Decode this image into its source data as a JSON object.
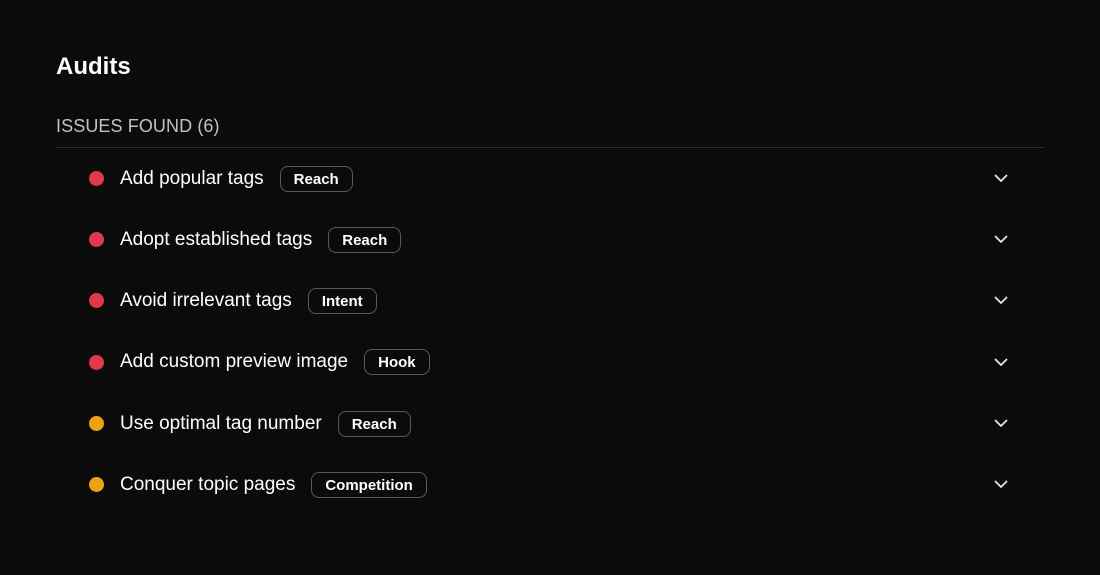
{
  "page": {
    "title": "Audits",
    "section_header": "ISSUES FOUND (6)"
  },
  "colors": {
    "background": "#0b0b0b",
    "severity_high": "#e0394a",
    "severity_medium": "#eba312",
    "divider": "#2c2c2c",
    "tag_border": "#5a5a5a"
  },
  "issues": [
    {
      "label": "Add popular tags",
      "tag": "Reach",
      "severity": "high",
      "icon": "chevron-down-icon"
    },
    {
      "label": "Adopt established tags",
      "tag": "Reach",
      "severity": "high",
      "icon": "chevron-down-icon"
    },
    {
      "label": "Avoid irrelevant tags",
      "tag": "Intent",
      "severity": "high",
      "icon": "chevron-down-icon"
    },
    {
      "label": "Add custom preview image",
      "tag": "Hook",
      "severity": "high",
      "icon": "chevron-down-icon"
    },
    {
      "label": "Use optimal tag number",
      "tag": "Reach",
      "severity": "medium",
      "icon": "chevron-down-icon"
    },
    {
      "label": "Conquer topic pages",
      "tag": "Competition",
      "severity": "medium",
      "icon": "chevron-down-icon"
    }
  ]
}
